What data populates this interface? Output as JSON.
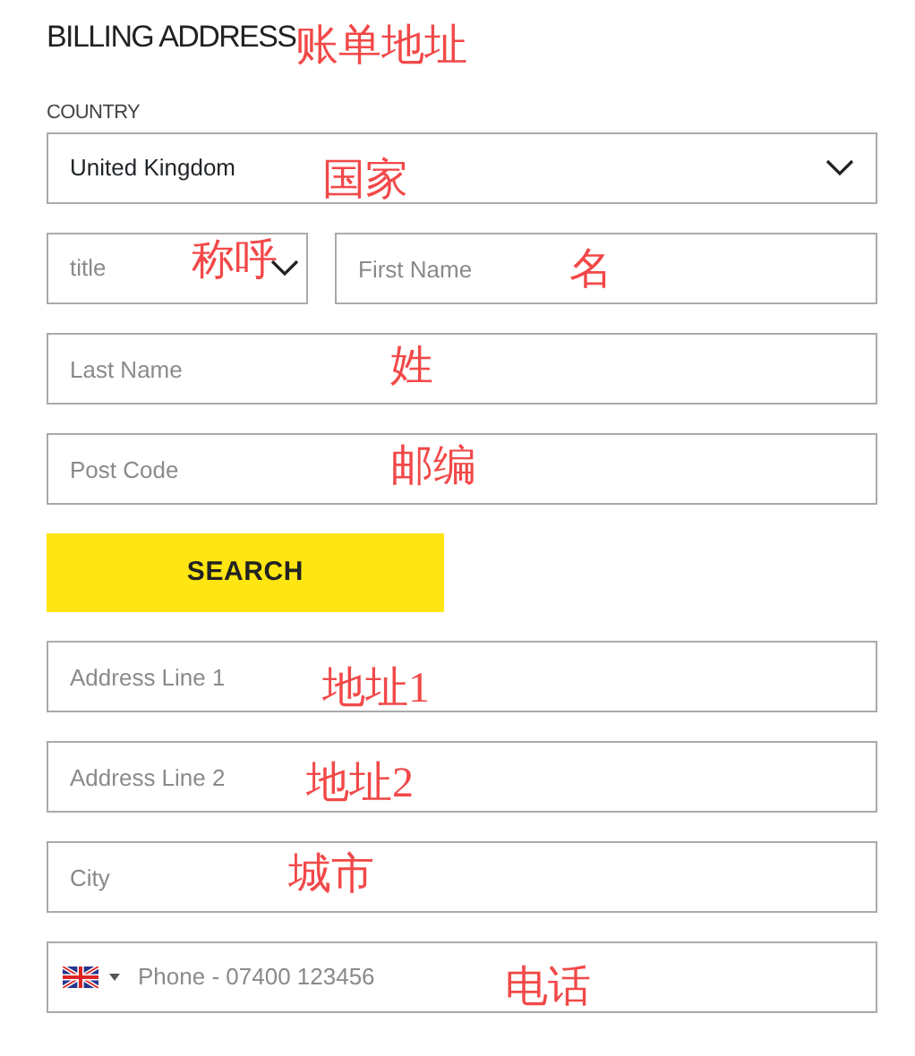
{
  "heading": {
    "text": "BILLING ADDRESS",
    "annotation": "账单地址"
  },
  "form": [
    {
      "kind": "select",
      "label": "COUNTRY",
      "value": "United Kingdom",
      "annotation": "国家"
    },
    {
      "kind": "pair",
      "items": [
        {
          "kind": "select",
          "placeholder": "title",
          "annotation": "称呼"
        },
        {
          "kind": "text",
          "placeholder": "First Name",
          "annotation": "名"
        }
      ]
    },
    {
      "kind": "text",
      "placeholder": "Last Name",
      "annotation": "姓"
    },
    {
      "kind": "text",
      "placeholder": "Post Code",
      "annotation": "邮编"
    },
    {
      "kind": "button",
      "label": "SEARCH"
    },
    {
      "kind": "text",
      "placeholder": "Address Line 1",
      "annotation": "地址1"
    },
    {
      "kind": "text",
      "placeholder": "Address Line 2",
      "annotation": "地址2"
    },
    {
      "kind": "text",
      "placeholder": "City",
      "annotation": "城市"
    },
    {
      "kind": "phone",
      "placeholder": "Phone - 07400 123456",
      "annotation": "电话"
    }
  ]
}
